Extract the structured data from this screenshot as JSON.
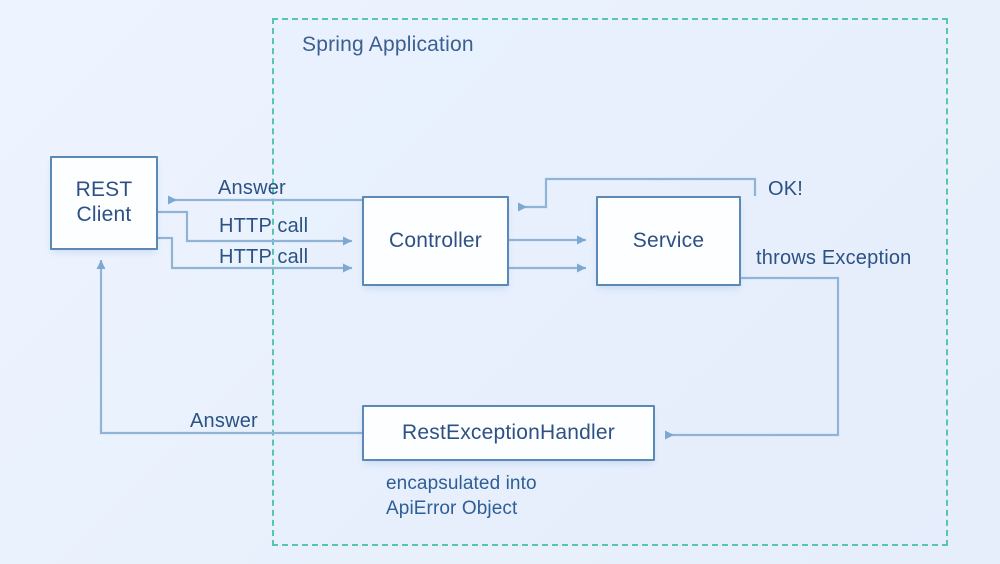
{
  "diagram": {
    "title": "Spring Application",
    "background_color": "#eef4ff",
    "accent_color": "#5c88b6",
    "group_border_color": "#58c4b2",
    "text_color": "#2e5184",
    "nodes": {
      "rest_client": "REST\nClient",
      "rest_client_line1": "REST",
      "rest_client_line2": "Client",
      "controller": "Controller",
      "service": "Service",
      "rest_exception_handler": "RestExceptionHandler"
    },
    "edges": {
      "answer_top": "Answer",
      "http_call_1": "HTTP call",
      "http_call_2": "HTTP call",
      "ok": "OK!",
      "throws_exception": "throws Exception",
      "answer_bottom": "Answer"
    },
    "notes": {
      "encapsulated": "encapsulated into\nApiError Object"
    }
  }
}
